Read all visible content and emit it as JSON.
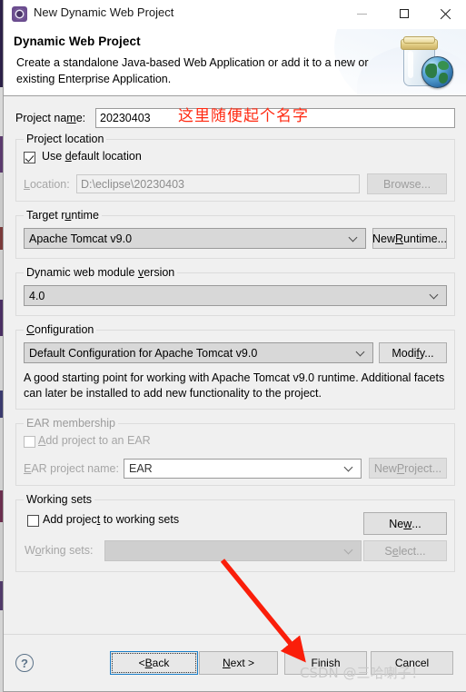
{
  "window": {
    "title": "New Dynamic Web Project",
    "icon": "gear-icon",
    "minimize_label": "—",
    "maximize_label": "□",
    "close_label": "✕"
  },
  "banner": {
    "title": "Dynamic Web Project",
    "description": "Create a standalone Java-based Web Application or add it to a new or existing Enterprise Application.",
    "art": "jar-globe-icon"
  },
  "form": {
    "project_name_label": "Project name:",
    "project_name_value": "20230403",
    "project_location": {
      "legend": "Project location",
      "use_default_label": "Use default location",
      "use_default_checked": true,
      "location_label": "Location:",
      "location_value": "D:\\eclipse\\20230403",
      "browse_label": "Browse..."
    },
    "target_runtime": {
      "legend": "Target runtime",
      "value": "Apache Tomcat v9.0",
      "new_runtime_label": "New Runtime..."
    },
    "module_version": {
      "legend": "Dynamic web module version",
      "value": "4.0"
    },
    "configuration": {
      "legend": "Configuration",
      "value": "Default Configuration for Apache Tomcat v9.0",
      "modify_label": "Modify...",
      "description": "A good starting point for working with Apache Tomcat v9.0 runtime. Additional facets can later be installed to add new functionality to the project."
    },
    "ear_membership": {
      "legend": "EAR membership",
      "add_to_ear_label": "Add project to an EAR",
      "add_to_ear_checked": false,
      "ear_project_name_label": "EAR project name:",
      "ear_project_name_value": "EAR",
      "new_project_label": "New Project..."
    },
    "working_sets": {
      "legend": "Working sets",
      "add_to_working_sets_label": "Add project to working sets",
      "add_to_working_sets_checked": false,
      "new_label": "New...",
      "working_sets_label": "Working sets:",
      "working_sets_value": "",
      "select_label": "Select..."
    }
  },
  "buttons": {
    "help": "?",
    "back": "< Back",
    "next": "Next >",
    "finish": "Finish",
    "cancel": "Cancel"
  },
  "annotations": {
    "note_text": "这里随便起个名字",
    "note_color": "#ff2a12",
    "arrow_color": "#fa1e0a",
    "watermark": "CSDN @三哈喇子！"
  }
}
